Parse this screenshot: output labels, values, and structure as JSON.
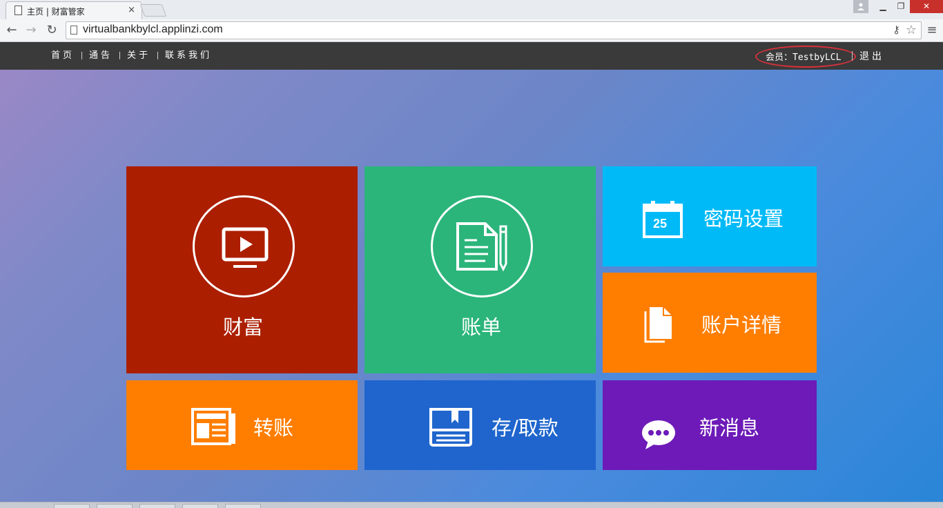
{
  "browser": {
    "tab_title": "主页 | 财富管家",
    "tab_close": "×",
    "url": "virtualbankbylcl.applinzi.com",
    "window_controls": {
      "minimize": "▁",
      "maximize": "❐",
      "close": "✕"
    },
    "nav": {
      "back": "←",
      "forward": "→",
      "reload": "↻"
    },
    "icons": {
      "key": "⚷",
      "star": "☆",
      "menu": "≡"
    }
  },
  "topnav": {
    "links": [
      "首页",
      "通告",
      "关于",
      "联系我们"
    ],
    "member_label": "会员：TestbyLCL",
    "logout": "退出"
  },
  "tiles": {
    "wealth": {
      "label": "财富",
      "icon": "tv-play-icon",
      "color": "#ac1e00"
    },
    "bill": {
      "label": "账单",
      "icon": "document-pencil-icon",
      "color": "#2bb57a"
    },
    "password": {
      "label": "密码设置",
      "icon": "calendar-icon",
      "calendar_day": "25",
      "color": "#00baf7"
    },
    "account": {
      "label": "账户详情",
      "icon": "files-icon",
      "color": "#ff7e00"
    },
    "transfer": {
      "label": "转账",
      "icon": "newspaper-icon",
      "color": "#ff7e00"
    },
    "deposit": {
      "label": "存/取款",
      "icon": "book-icon",
      "color": "#1f65cd"
    },
    "messages": {
      "label": "新消息",
      "icon": "chat-bubble-icon",
      "color": "#6d1ab8"
    }
  }
}
